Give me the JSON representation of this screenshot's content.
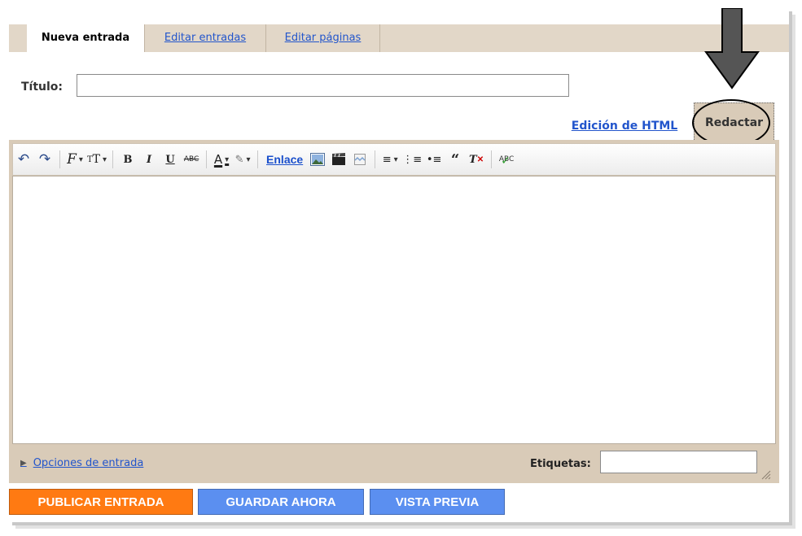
{
  "tabs": {
    "new_post": "Nueva entrada",
    "edit_posts": "Editar entradas",
    "edit_pages": "Editar páginas"
  },
  "title_field": {
    "label": "Título:",
    "value": ""
  },
  "editor_modes": {
    "html": "Edición de HTML",
    "compose": "Redactar"
  },
  "toolbar": {
    "link_label": "Enlace",
    "icons": [
      "undo-icon",
      "redo-icon",
      "font-family-icon",
      "font-size-icon",
      "bold-icon",
      "italic-icon",
      "underline-icon",
      "strikethrough-icon",
      "text-color-icon",
      "highlight-color-icon",
      "link",
      "image-icon",
      "video-icon",
      "jump-break-icon",
      "align-icon",
      "numbered-list-icon",
      "bulleted-list-icon",
      "quote-icon",
      "remove-formatting-icon",
      "spellcheck-icon"
    ]
  },
  "post_options": {
    "label": "Opciones de entrada"
  },
  "labels_field": {
    "label": "Etiquetas:",
    "value": ""
  },
  "actions": {
    "publish": "PUBLICAR ENTRADA",
    "save": "GUARDAR AHORA",
    "preview": "VISTA PREVIA"
  },
  "colors": {
    "tabbar_bg": "#e2d7c8",
    "link": "#2255cc",
    "publish_bg": "#ff7a12",
    "secondary_btn_bg": "#5b8ff0",
    "annotation_arrow": "#555555"
  }
}
